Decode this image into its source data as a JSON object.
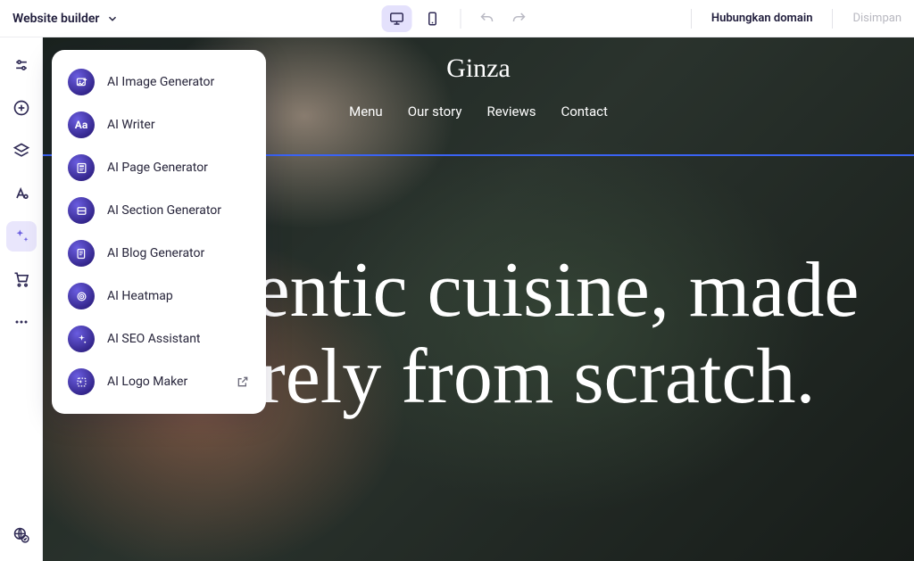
{
  "header": {
    "app_title": "Website builder",
    "connect_domain": "Hubungkan domain",
    "saved": "Disimpan"
  },
  "sidebar_icons": {
    "adjust": "adjust-icon",
    "add": "add-icon",
    "layers": "layers-icon",
    "text_style": "text-style-icon",
    "ai": "ai-sparkle-icon",
    "cart": "cart-icon",
    "more": "more-icon",
    "globe": "globe-language-icon"
  },
  "ai_tools": [
    {
      "label": "AI Image Generator",
      "icon": "image-plus-icon",
      "external": false
    },
    {
      "label": "AI Writer",
      "icon": "text-aa-icon",
      "external": false
    },
    {
      "label": "AI Page Generator",
      "icon": "page-icon",
      "external": false
    },
    {
      "label": "AI Section Generator",
      "icon": "section-icon",
      "external": false
    },
    {
      "label": "AI Blog Generator",
      "icon": "blog-icon",
      "external": false
    },
    {
      "label": "AI Heatmap",
      "icon": "heatmap-icon",
      "external": false
    },
    {
      "label": "AI SEO Assistant",
      "icon": "seo-star-icon",
      "external": false
    },
    {
      "label": "AI Logo Maker",
      "icon": "logo-maker-icon",
      "external": true
    }
  ],
  "site": {
    "title": "Ginza",
    "nav": [
      "Menu",
      "Our story",
      "Reviews",
      "Contact"
    ],
    "hero": "Authentic cuisine, made entirely from scratch."
  },
  "colors": {
    "accent": "#6a5de0",
    "accent_bg": "#e9e6fc",
    "selection_outline": "#3a63f5"
  }
}
